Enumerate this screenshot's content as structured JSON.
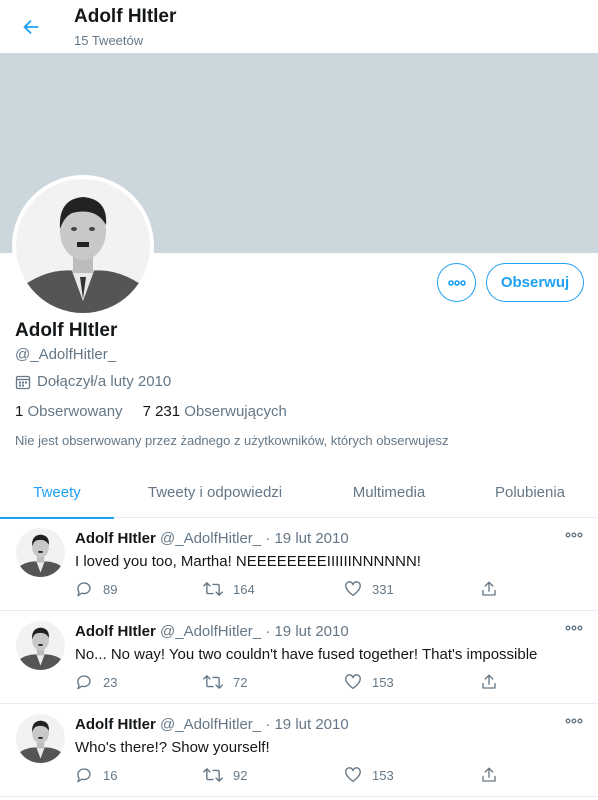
{
  "header": {
    "title": "Adolf HItler",
    "tweet_count": "15 Tweetów"
  },
  "profile": {
    "name": "Adolf HItler",
    "handle": "@_AdolfHitler_",
    "joined": "Dołączył/a luty 2010",
    "following_count": "1",
    "following_label": "Obserwowany",
    "followers_count": "7 231",
    "followers_label": "Obserwujących",
    "note": "Nie jest obserwowany przez żadnego z użytkowników, których obserwujesz",
    "follow_button": "Obserwuj"
  },
  "tabs": [
    {
      "label": "Tweety"
    },
    {
      "label": "Tweety i odpowiedzi"
    },
    {
      "label": "Multimedia"
    },
    {
      "label": "Polubienia"
    }
  ],
  "tweets": [
    {
      "name": "Adolf HItler",
      "handle": "@_AdolfHitler_",
      "date": "19 lut 2010",
      "text": "I loved you too, Martha! NEEEEEEEEIIIIIINNNNNN!",
      "replies": "89",
      "retweets": "164",
      "likes": "331"
    },
    {
      "name": "Adolf HItler",
      "handle": "@_AdolfHitler_",
      "date": "19 lut 2010",
      "text": "No... No way! You two couldn't have fused together! That's impossible",
      "replies": "23",
      "retweets": "72",
      "likes": "153"
    },
    {
      "name": "Adolf HItler",
      "handle": "@_AdolfHitler_",
      "date": "19 lut 2010",
      "text": "Who's there!? Show yourself!",
      "replies": "16",
      "retweets": "92",
      "likes": "153"
    }
  ],
  "colors": {
    "accent": "#1da1f2",
    "banner": "#ccd6dd",
    "muted_text": "#657786"
  },
  "icons": [
    "back-arrow-icon",
    "more-icon",
    "calendar-icon",
    "reply-icon",
    "retweet-icon",
    "like-icon",
    "share-icon"
  ]
}
